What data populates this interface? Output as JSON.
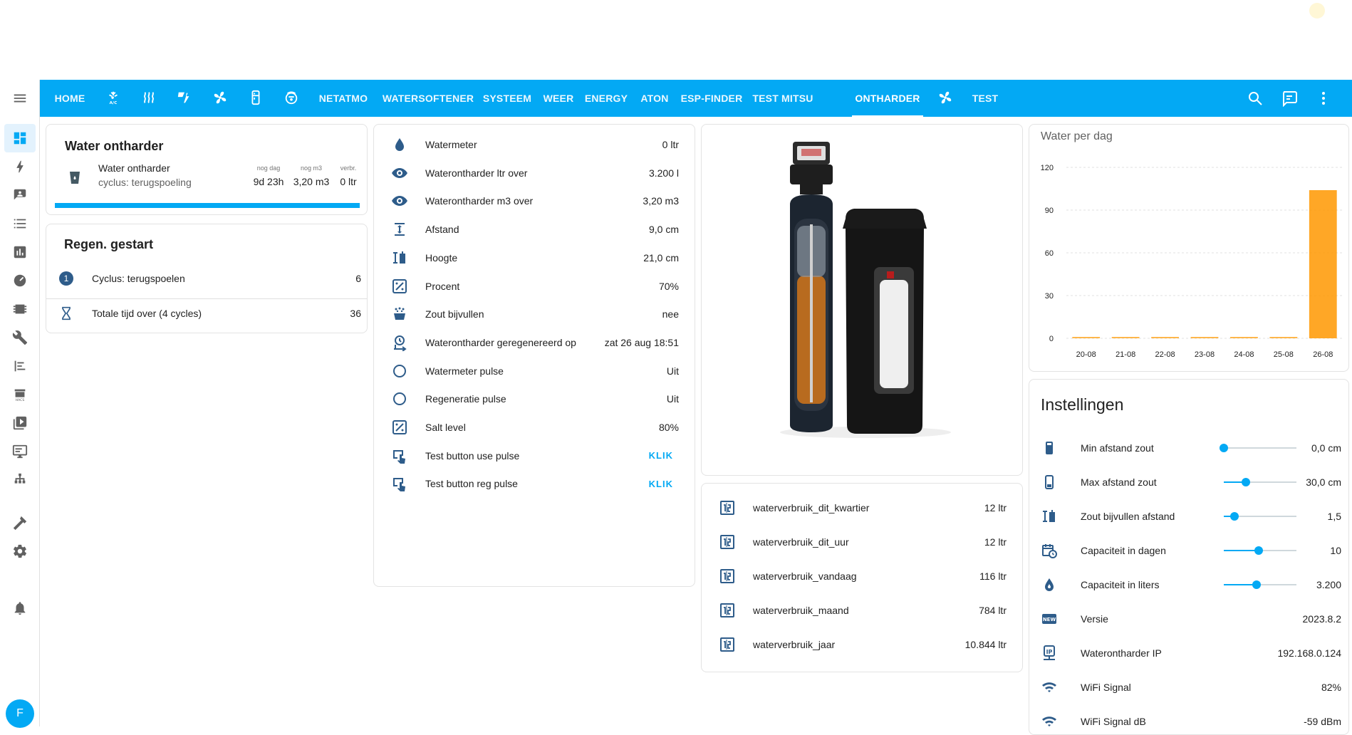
{
  "header": {
    "tabs": [
      {
        "label": "HOME"
      },
      {
        "icon": "air-conditioner-icon"
      },
      {
        "icon": "heat-waves-icon"
      },
      {
        "icon": "solar-power-icon"
      },
      {
        "icon": "fan-icon"
      },
      {
        "icon": "fridge-icon"
      },
      {
        "icon": "robot-vacuum-icon"
      },
      {
        "label": "NETATMO"
      },
      {
        "label": "WATERSOFTENER"
      },
      {
        "label": "SYSTEEM"
      },
      {
        "label": "WEER"
      },
      {
        "label": "ENERGY"
      },
      {
        "label": "ATON"
      },
      {
        "label": "ESP-FINDER"
      },
      {
        "label": "TEST MITSU"
      },
      {
        "label": "ONTHARDER",
        "active": true
      },
      {
        "icon": "fan-icon"
      },
      {
        "label": "TEST"
      }
    ],
    "color": "#03a9f4"
  },
  "sidebar": {
    "items": [
      "dashboard-icon",
      "energy-icon",
      "map-icon",
      "logbook-icon",
      "history-icon",
      "dashboard-gauge-icon",
      "esphome-icon",
      "tools-icon",
      "list-icon",
      "hacs-icon",
      "media-icon",
      "terminal-icon",
      "network-icon",
      "developer-tools-icon",
      "settings-icon",
      "notifications-icon"
    ],
    "avatar": "F"
  },
  "softener_card": {
    "title": "Water ontharder",
    "name": "Water ontharder",
    "status": "cyclus: terugspoeling",
    "stats": [
      {
        "label": "nog dag",
        "value": "9d 23h"
      },
      {
        "label": "nog m3",
        "value": "3,20 m3"
      },
      {
        "label": "verbr.",
        "value": "0 ltr"
      }
    ],
    "progress": 1.0
  },
  "regen_card": {
    "title": "Regen. gestart",
    "rows": [
      {
        "label": "Cyclus: terugspoelen",
        "value": "6",
        "badge": "1"
      },
      {
        "label": "Totale tijd over (4 cycles)",
        "value": "36"
      }
    ]
  },
  "entities_card": {
    "rows": [
      {
        "icon": "water-drop-icon",
        "label": "Watermeter",
        "value": "0 ltr"
      },
      {
        "icon": "eye-icon",
        "label": "Waterontharder ltr over",
        "value": "3.200 l"
      },
      {
        "icon": "eye-icon",
        "label": "Waterontharder m3 over",
        "value": "3,20 m3"
      },
      {
        "icon": "distance-icon",
        "label": "Afstand",
        "value": "9,0 cm"
      },
      {
        "icon": "height-icon",
        "label": "Hoogte",
        "value": "21,0 cm"
      },
      {
        "icon": "percent-icon",
        "label": "Procent",
        "value": "70%"
      },
      {
        "icon": "salt-icon",
        "label": "Zout bijvullen",
        "value": "nee"
      },
      {
        "icon": "clock-arrow-icon",
        "label": "Waterontharder geregenereerd op",
        "value": "zat 26 aug 18:51"
      },
      {
        "icon": "circle-icon",
        "label": "Watermeter pulse",
        "value": "Uit"
      },
      {
        "icon": "circle-icon",
        "label": "Regeneratie pulse",
        "value": "Uit"
      },
      {
        "icon": "percent-icon",
        "label": "Salt level",
        "value": "80%"
      },
      {
        "icon": "gesture-tap-icon",
        "label": "Test button use pulse",
        "value": "KLIK",
        "button": true
      },
      {
        "icon": "gesture-tap-icon",
        "label": "Test button reg pulse",
        "value": "KLIK",
        "button": true
      }
    ]
  },
  "usage_card": {
    "rows": [
      {
        "icon": "counter-icon",
        "label": "waterverbruik_dit_kwartier",
        "value": "12 ltr"
      },
      {
        "icon": "counter-icon",
        "label": "waterverbruik_dit_uur",
        "value": "12 ltr"
      },
      {
        "icon": "counter-icon",
        "label": "waterverbruik_vandaag",
        "value": "116 ltr"
      },
      {
        "icon": "counter-icon",
        "label": "waterverbruik_maand",
        "value": "784 ltr"
      },
      {
        "icon": "counter-icon",
        "label": "waterverbruik_jaar",
        "value": "10.844 ltr"
      }
    ]
  },
  "chart_data": {
    "type": "bar",
    "title": "Water per dag",
    "categories": [
      "20-08",
      "21-08",
      "22-08",
      "23-08",
      "24-08",
      "25-08",
      "26-08"
    ],
    "values": [
      0,
      0,
      0,
      0,
      0,
      0,
      104
    ],
    "ylim": [
      0,
      120
    ],
    "yticks": [
      "120",
      "90",
      "60",
      "30",
      "0"
    ],
    "grid": true,
    "color": "#ff9800"
  },
  "settings_card": {
    "title": "Instellingen",
    "rows": [
      {
        "icon": "tank-icon",
        "label": "Min afstand zout",
        "value": "0,0 cm",
        "slider": 0.0
      },
      {
        "icon": "tank-low-icon",
        "label": "Max afstand zout",
        "value": "30,0 cm",
        "slider": 0.3
      },
      {
        "icon": "height-icon",
        "label": "Zout bijvullen afstand",
        "value": "1,5",
        "slider": 0.15
      },
      {
        "icon": "calendar-clock-icon",
        "label": "Capaciteit in dagen",
        "value": "10",
        "slider": 0.48
      },
      {
        "icon": "water-flame-icon",
        "label": "Capaciteit in liters",
        "value": "3.200",
        "slider": 0.45
      },
      {
        "icon": "new-box-icon",
        "label": "Versie",
        "value": "2023.8.2"
      },
      {
        "icon": "ip-network-icon",
        "label": "Waterontharder IP",
        "value": "192.168.0.124"
      },
      {
        "icon": "wifi-icon",
        "label": "WiFi Signal",
        "value": "82%"
      },
      {
        "icon": "wifi-icon",
        "label": "WiFi Signal dB",
        "value": "-59 dBm"
      }
    ]
  }
}
